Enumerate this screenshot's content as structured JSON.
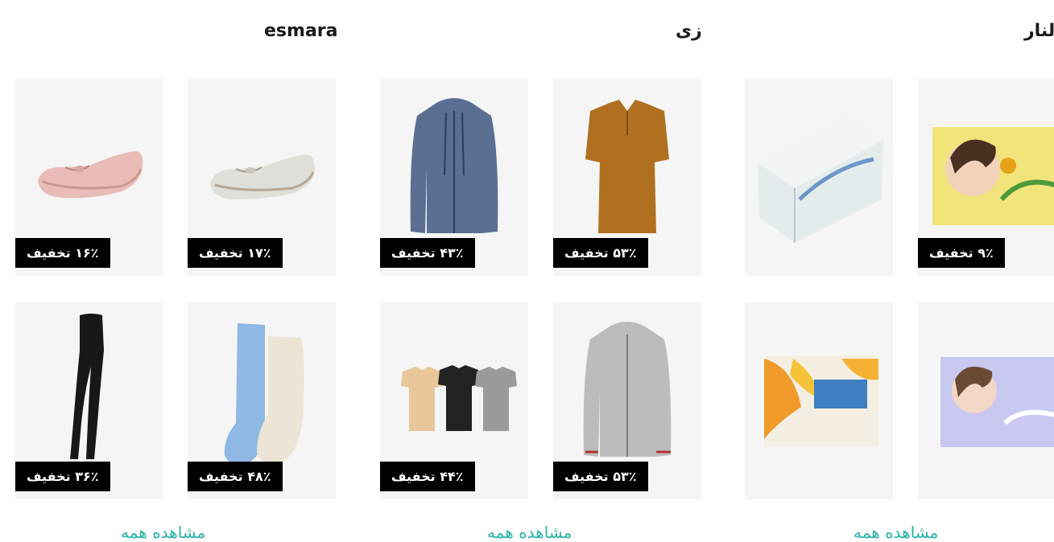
{
  "stores": [
    {
      "name": "esmara",
      "view_all": "مشاهده همه",
      "products": [
        {
          "icon": "pink-flat-shoe",
          "discount": "۱۶٪ تخفیف"
        },
        {
          "icon": "white-flat-shoe",
          "discount": "۱۷٪ تخفیف"
        },
        {
          "icon": "black-tights",
          "discount": "۳۶٪ تخفیف"
        },
        {
          "icon": "fluffy-socks",
          "discount": "۴۸٪ تخفیف"
        }
      ]
    },
    {
      "name": "زی",
      "view_all": "مشاهده همه",
      "products": [
        {
          "icon": "blue-hoodie",
          "discount": "۴۳٪ تخفیف"
        },
        {
          "icon": "mustard-polo-shirt",
          "discount": "۵۳٪ تخفیف"
        },
        {
          "icon": "tshirt-pack",
          "discount": "۴۴٪ تخفیف"
        },
        {
          "icon": "grey-hoodie",
          "discount": "۵۳٪ تخفیف"
        }
      ]
    },
    {
      "name": "لنار",
      "view_all": "مشاهده همه",
      "products": [
        {
          "icon": "tissue-box",
          "discount": ""
        },
        {
          "icon": "golnar-soap",
          "discount": "۹٪ تخفیف"
        },
        {
          "icon": "golnar-soap-box",
          "discount": ""
        },
        {
          "icon": "golnar-soap-purple",
          "discount": ""
        }
      ]
    }
  ],
  "colors": {
    "tile_background": "#f5f5f5",
    "badge_background": "#000000",
    "badge_text": "#ffffff",
    "view_all": "#27b3a9"
  }
}
